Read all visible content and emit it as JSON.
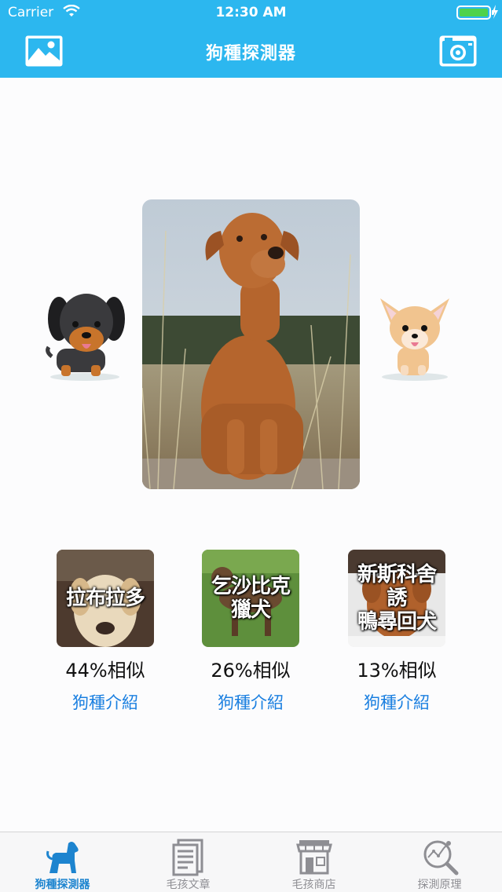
{
  "status_bar": {
    "carrier": "Carrier",
    "time": "12:30 AM"
  },
  "nav": {
    "title": "狗種探測器",
    "left_icon": "photo-library-icon",
    "right_icon": "camera-icon"
  },
  "results": [
    {
      "name": "拉布拉多",
      "similarity": "44%相似",
      "link": "狗種介紹"
    },
    {
      "name": "乞沙比克獵犬",
      "name_line1": "乞沙比克",
      "name_line2": "獵犬",
      "similarity": "26%相似",
      "link": "狗種介紹"
    },
    {
      "name": "新斯科舍誘鴨尋回犬",
      "name_line1": "新斯科舍誘",
      "name_line2": "鴨尋回犬",
      "similarity": "13%相似",
      "link": "狗種介紹"
    }
  ],
  "tabs": [
    {
      "label": "狗種探測器",
      "icon": "dog-icon",
      "active": true
    },
    {
      "label": "毛孩文章",
      "icon": "newspaper-icon",
      "active": false
    },
    {
      "label": "毛孩商店",
      "icon": "store-icon",
      "active": false
    },
    {
      "label": "探測原理",
      "icon": "magnifier-chart-icon",
      "active": false
    }
  ],
  "colors": {
    "header": "#2cb7ef",
    "link": "#1a7fe0",
    "tab_active": "#1d84cf",
    "tab_inactive": "#8e8e93"
  }
}
